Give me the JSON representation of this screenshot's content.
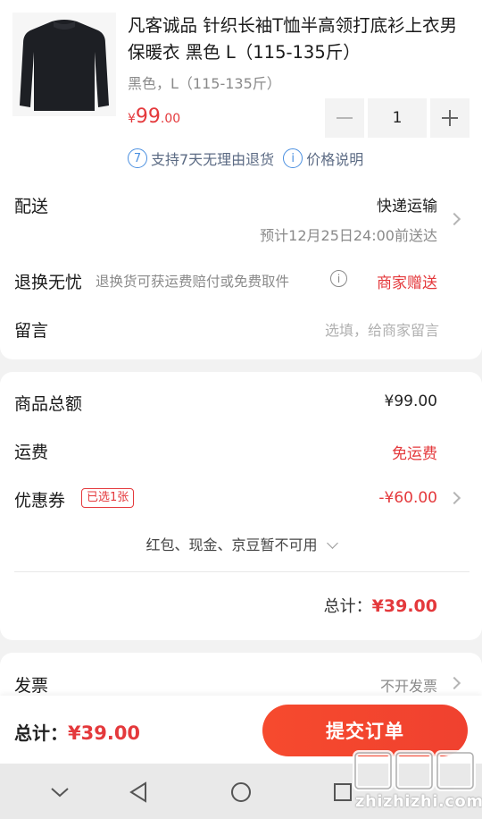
{
  "product": {
    "image_icon": "black-sweater-image",
    "title": "凡客诚品 针织长袖T恤半高领打底衫上衣男保暖衣 黑色 L（115-135斤）",
    "spec": "黑色，L（115-135斤）",
    "price_currency": "¥",
    "price_int": "99",
    "price_dec": ".00",
    "quantity": "1",
    "service_badge_num": "7",
    "service_return": "支持7天无理由退货",
    "service_info_icon": "i",
    "service_price_note": "价格说明"
  },
  "delivery": {
    "label": "配送",
    "method": "快递运输",
    "estimate": "预计12月25日24:00前送达"
  },
  "return_worry_free": {
    "label": "退换无忧",
    "desc": "退换货可获运费赔付或免费取件",
    "info_icon": "i",
    "badge": "商家赠送"
  },
  "message": {
    "label": "留言",
    "placeholder": "选填，给商家留言"
  },
  "summary": {
    "goods_total_label": "商品总额",
    "goods_total_value": "¥99.00",
    "shipping_label": "运费",
    "shipping_value": "免运费",
    "coupon_label": "优惠券",
    "coupon_tag": "已选1张",
    "coupon_value": "-¥60.00",
    "unavailable_note": "红包、现金、京豆暂不可用",
    "total_label": "总计：",
    "total_value": "¥39.00"
  },
  "invoice": {
    "label": "发票",
    "value": "不开发票"
  },
  "bottom_bar": {
    "total_label": "总计：",
    "total_value": "¥39.00",
    "submit_label": "提交订单"
  },
  "watermark": {
    "text": "zhizhizhi.com"
  },
  "colors": {
    "accent_red": "#e4393c",
    "submit_orange": "#f64a2e",
    "service_blue": "#4a8fe0"
  }
}
